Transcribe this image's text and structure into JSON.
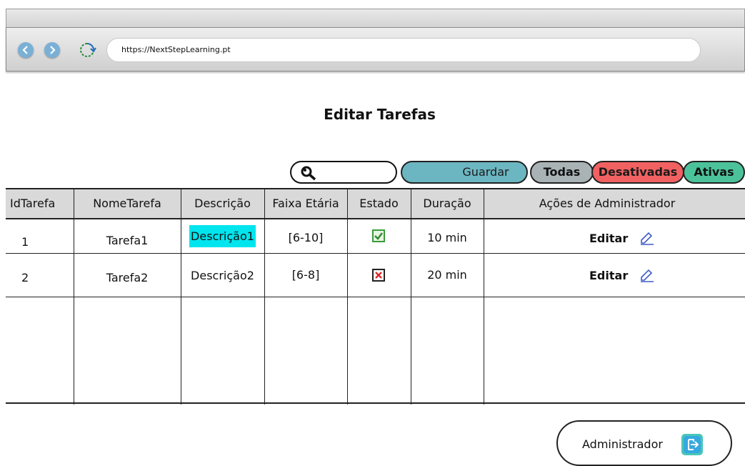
{
  "browser": {
    "url": "https://NextStepLearning.pt"
  },
  "page": {
    "title": "Editar Tarefas"
  },
  "toolbar": {
    "search_value": "",
    "guardar_label": "Guardar",
    "filters": {
      "todas": "Todas",
      "desativadas": "Desativadas",
      "ativas": "Ativas"
    }
  },
  "table": {
    "headers": [
      "IdTarefa",
      "NomeTarefa",
      "Descrição",
      "Faixa Etária",
      "Estado",
      "Duração",
      "Ações de Administrador"
    ],
    "rows": [
      {
        "id": "1",
        "nome": "Tarefa1",
        "descricao": "Descrição1",
        "faixa": "[6-10]",
        "estado": "checked",
        "duracao": "10 min",
        "acao": "Editar"
      },
      {
        "id": "2",
        "nome": "Tarefa2",
        "descricao": "Descrição2",
        "faixa": "[6-8]",
        "estado": "unchecked",
        "duracao": "20 min",
        "acao": "Editar"
      }
    ]
  },
  "footer": {
    "admin_label": "Administrador"
  },
  "colors": {
    "guardar": "#6cb6c2",
    "todas": "#a9b3b6",
    "desativadas": "#f26161",
    "ativas": "#4cc29b",
    "highlight": "#00e5ee"
  },
  "icons": [
    "back-icon",
    "forward-icon",
    "reload-icon",
    "search-icon",
    "check-icon",
    "x-icon",
    "edit-icon",
    "logout-icon"
  ]
}
